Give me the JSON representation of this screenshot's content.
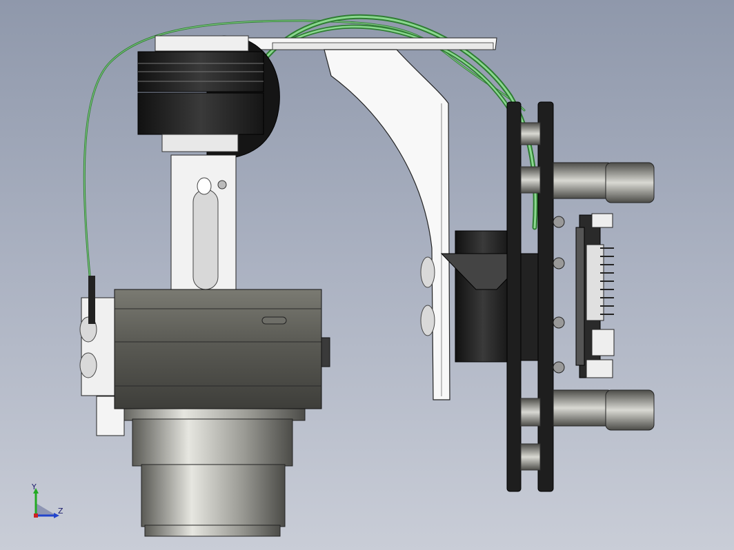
{
  "viewport": {
    "background_top": "#8f98ab",
    "background_bottom": "#c9cdd7"
  },
  "model": {
    "description_type": "cad-3d-assembly",
    "parts": [
      "camera-body",
      "camera-lens",
      "tilt-motor",
      "roll-motor",
      "mounting-arm",
      "mounting-plate",
      "damper-plate",
      "controller-board",
      "signal-wire"
    ],
    "colors": {
      "dark_part": "#2a2a2a",
      "metal_part": "#8a8a8a",
      "white_part": "#f4f4f4",
      "wire": "#4caf50",
      "camera_body": "#5a5a54"
    }
  },
  "orientation_triad": {
    "y_label": "Y",
    "z_label": "Z",
    "icon": "axis-triad-icon"
  }
}
